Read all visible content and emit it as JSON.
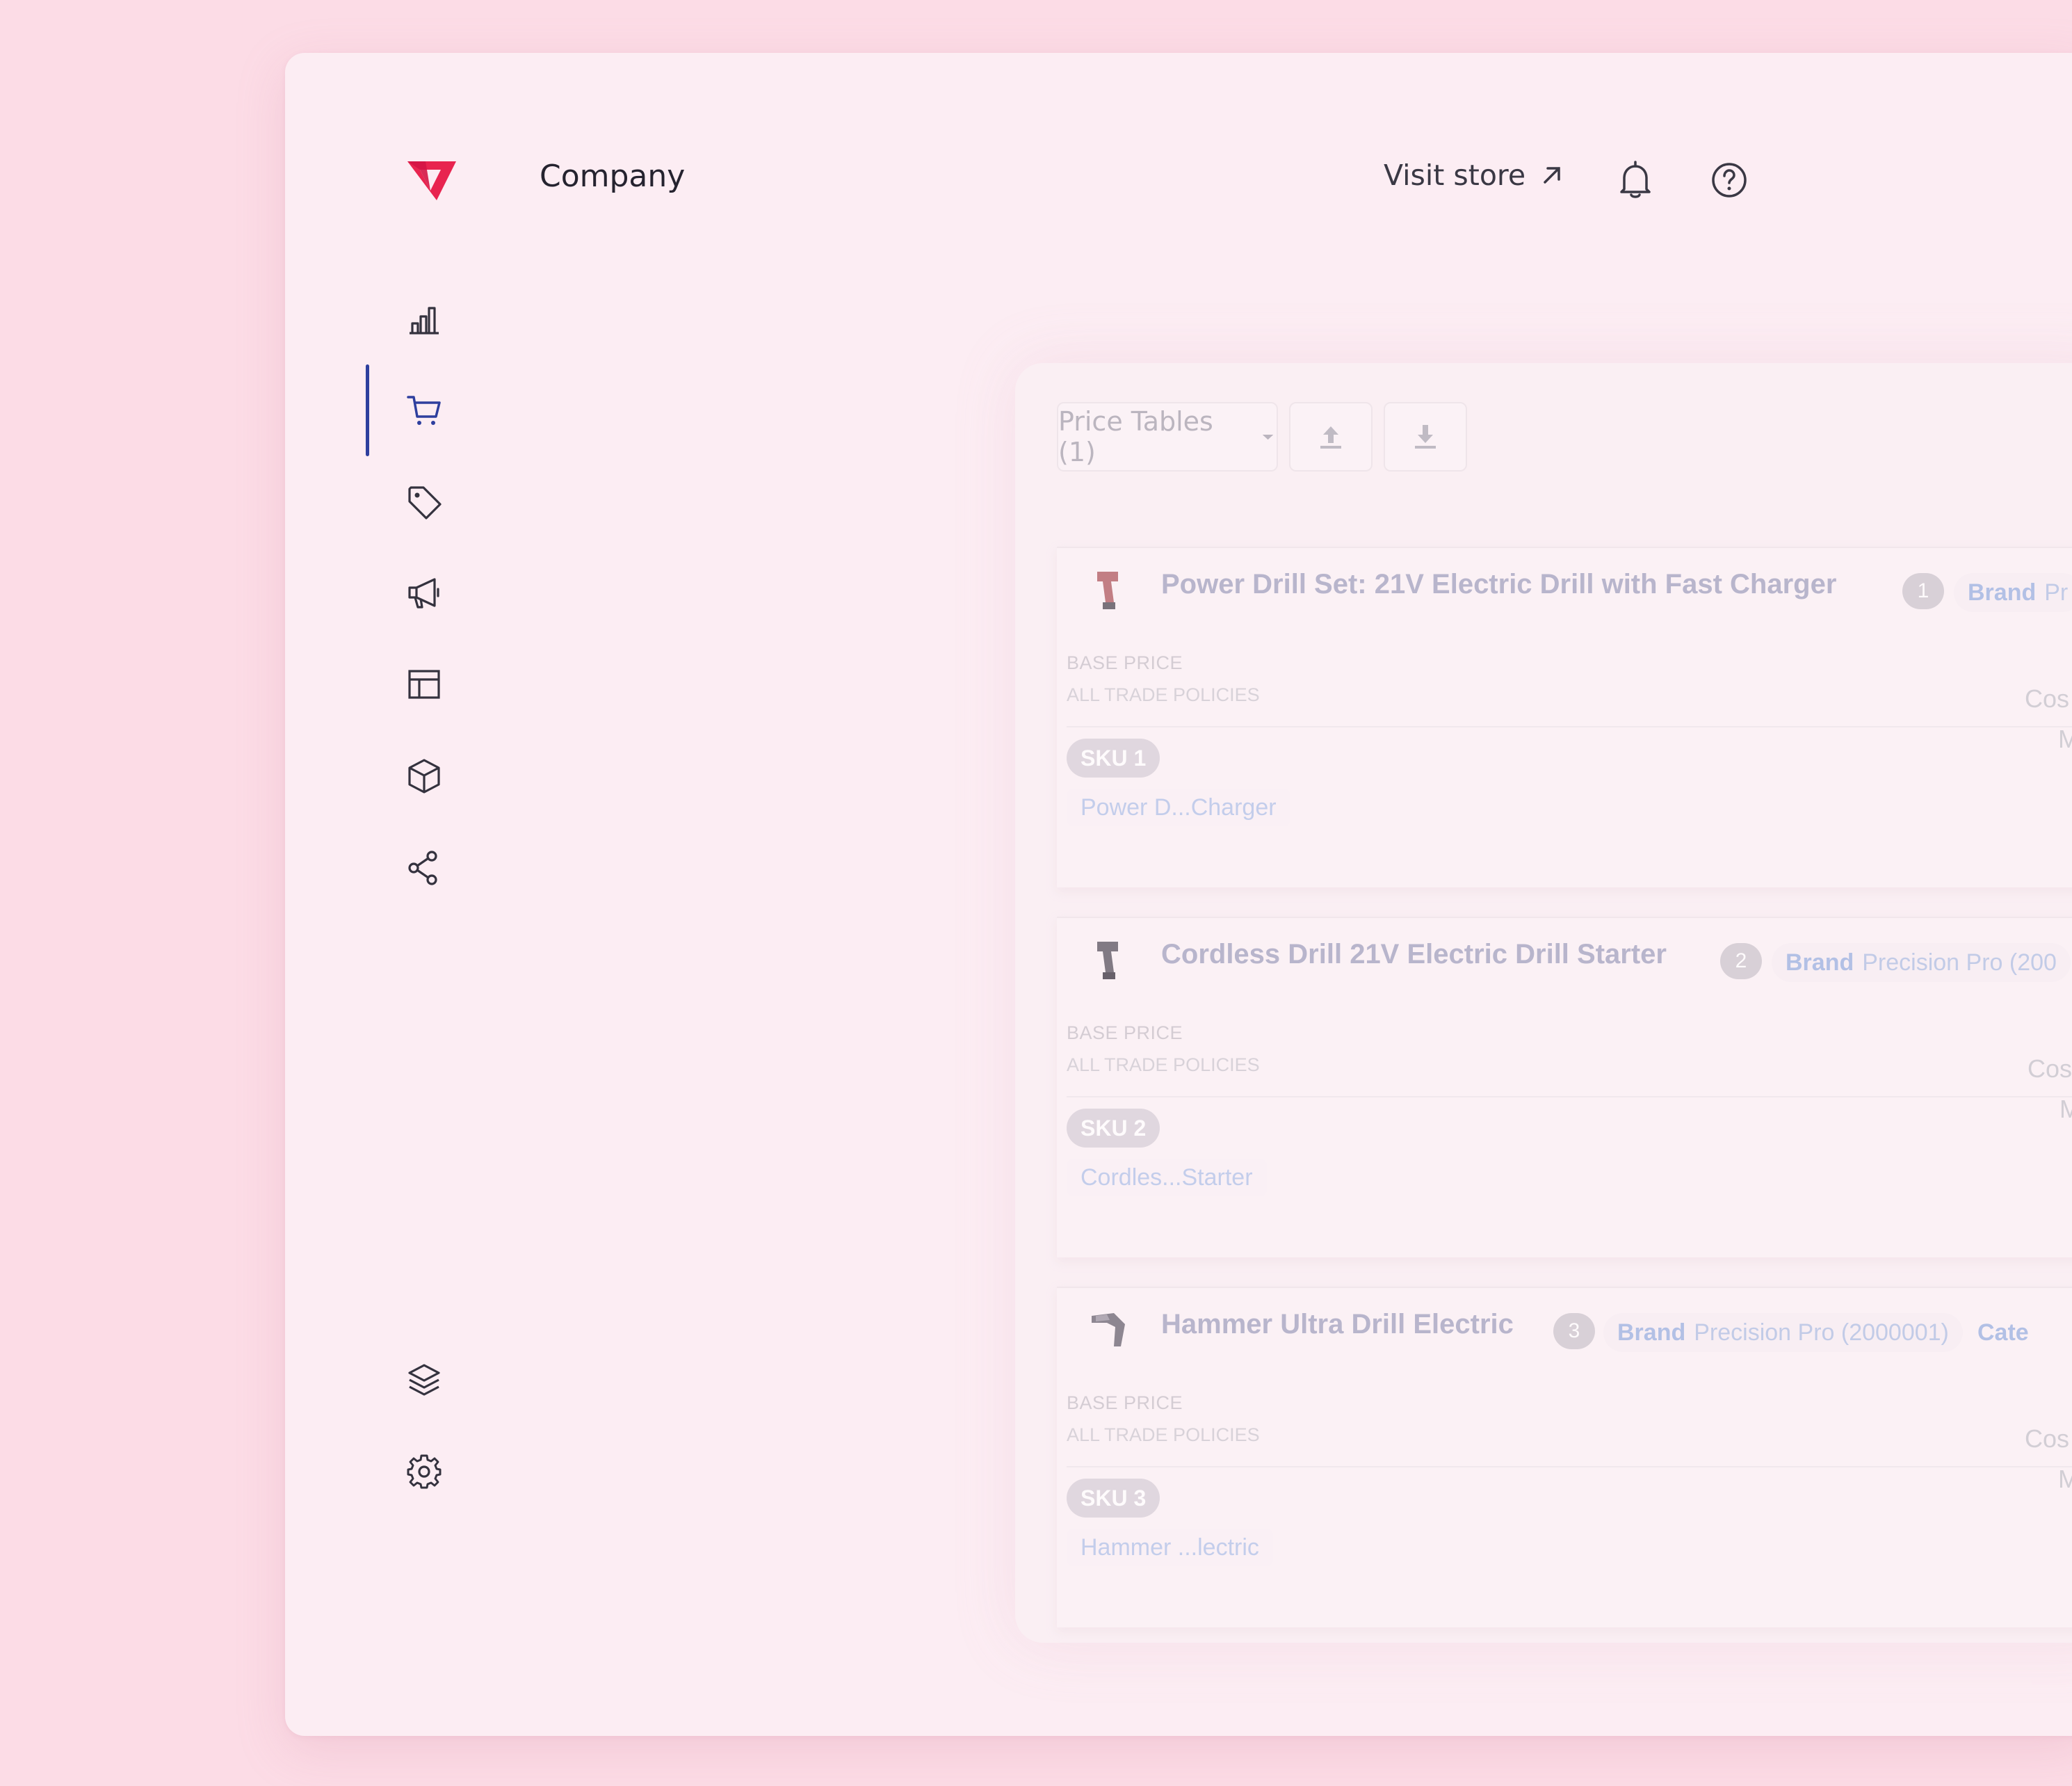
{
  "header": {
    "company": "Company",
    "visit_store": "Visit store"
  },
  "toolbar": {
    "price_tables": "Price Tables (1)"
  },
  "products": [
    {
      "title": "Power Drill Set: 21V Electric Drill with Fast Charger",
      "index": "1",
      "brand_label": "Brand",
      "brand_value": "Pr",
      "category_label": "",
      "base_price": "BASE PRICE",
      "trade_policies": "ALL TRADE POLICIES",
      "sku": "SKU 1",
      "sku_name": "Power D...Charger",
      "cost": "Cos",
      "m": "M"
    },
    {
      "title": "Cordless Drill 21V Electric Drill Starter",
      "index": "2",
      "brand_label": "Brand",
      "brand_value": "Precision Pro (200",
      "category_label": "",
      "base_price": "BASE PRICE",
      "trade_policies": "ALL TRADE POLICIES",
      "sku": "SKU 2",
      "sku_name": "Cordles...Starter",
      "cost": "Cos",
      "m": "M"
    },
    {
      "title": "Hammer Ultra Drill Electric",
      "index": "3",
      "brand_label": "Brand",
      "brand_value": "Precision Pro (2000001)",
      "category_label": "Cate",
      "base_price": "BASE PRICE",
      "trade_policies": "ALL TRADE POLICIES",
      "sku": "SKU 3",
      "sku_name": "Hammer ...lectric",
      "cost": "Cos",
      "m": "M"
    }
  ],
  "nav_icons": [
    "analytics-icon",
    "cart-icon",
    "tag-icon",
    "megaphone-icon",
    "layout-icon",
    "box-icon",
    "share-icon",
    "layers-icon",
    "settings-icon"
  ],
  "colors": {
    "background": "#fcdce6",
    "window": "#fcedf3",
    "brand_red": "#e31c58",
    "active_indicator": "#2e3f9e",
    "link_blue": "#9eb4e2"
  }
}
